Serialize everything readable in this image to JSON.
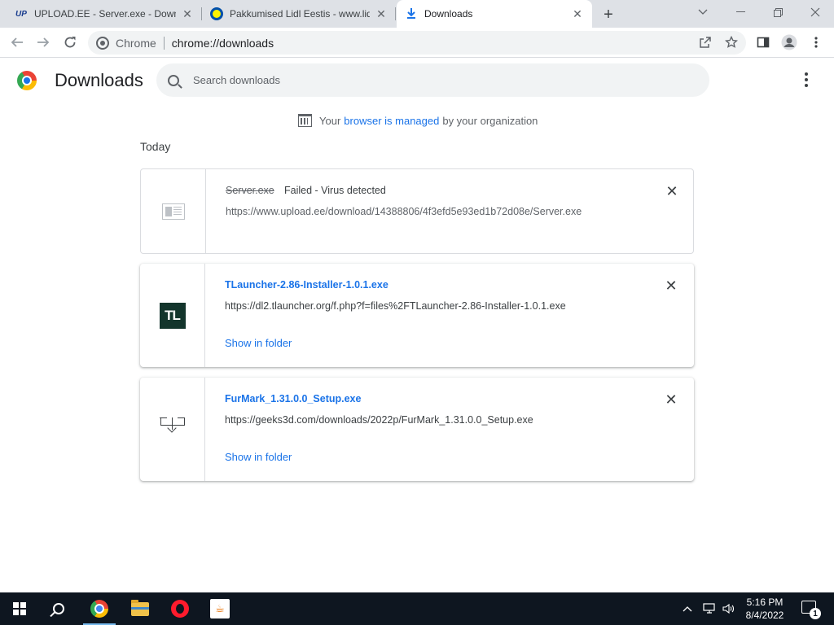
{
  "tabs": [
    {
      "title": "UPLOAD.EE - Server.exe - Download",
      "favicon": "UP"
    },
    {
      "title": "Pakkumised Lidl Eestis - www.lidl.ee"
    },
    {
      "title": "Downloads"
    }
  ],
  "omnibox": {
    "chip": "Chrome",
    "url": "chrome://downloads"
  },
  "page": {
    "title": "Downloads",
    "search_placeholder": "Search downloads",
    "managed_prefix": "Your",
    "managed_link": "browser is managed",
    "managed_suffix": "by your organization",
    "section": "Today"
  },
  "downloads": [
    {
      "name": "Server.exe",
      "status": "Failed - Virus detected",
      "url": "https://www.upload.ee/download/14388806/4f3efd5e93ed1b72d08e/Server.exe",
      "failed": true
    },
    {
      "name": "TLauncher-2.86-Installer-1.0.1.exe",
      "url": "https://dl2.tlauncher.org/f.php?f=files%2FTLauncher-2.86-Installer-1.0.1.exe",
      "action": "Show in folder",
      "icon_text": "TL"
    },
    {
      "name": "FurMark_1.31.0.0_Setup.exe",
      "url": "https://geeks3d.com/downloads/2022p/FurMark_1.31.0.0_Setup.exe",
      "action": "Show in folder"
    }
  ],
  "taskbar": {
    "time": "5:16 PM",
    "date": "8/4/2022",
    "notification_count": "1"
  },
  "colors": {
    "accent": "#1a73e8",
    "taskbar": "#0e1620",
    "tabstrip": "#dee1e6"
  }
}
